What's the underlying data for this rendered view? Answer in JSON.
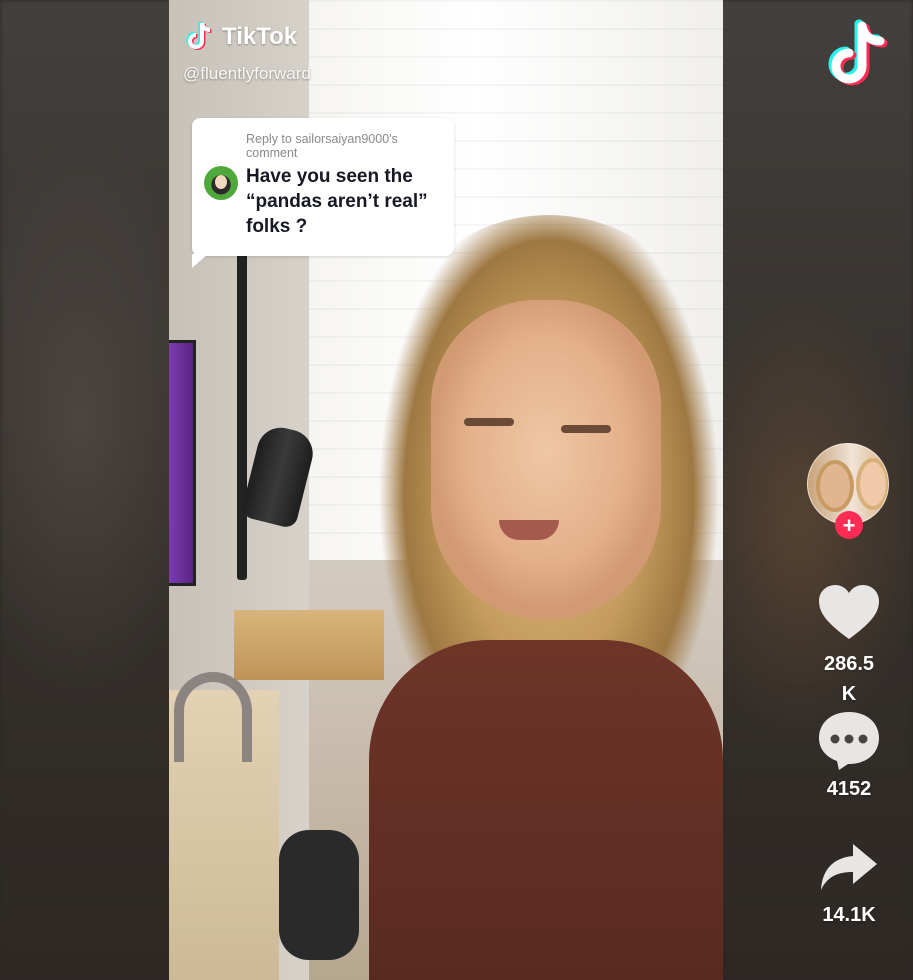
{
  "brand": {
    "name": "TikTok"
  },
  "creator": {
    "handle": "@fluentlyforward"
  },
  "reply": {
    "to": "Reply to sailorsaiyan9000's comment",
    "question": "Have you seen the “pandas aren’t real” folks ?"
  },
  "actions": {
    "likes": "286.5K",
    "comments": "4152",
    "shares": "14.1K"
  },
  "follow": {
    "label": "+"
  },
  "colors": {
    "tiktok_red": "#fe2c55",
    "tiktok_cyan": "#25f4ee",
    "text_dark": "#161823"
  },
  "icons": [
    "tiktok-logo-icon",
    "heart-icon",
    "comment-icon",
    "share-icon",
    "plus-icon"
  ]
}
